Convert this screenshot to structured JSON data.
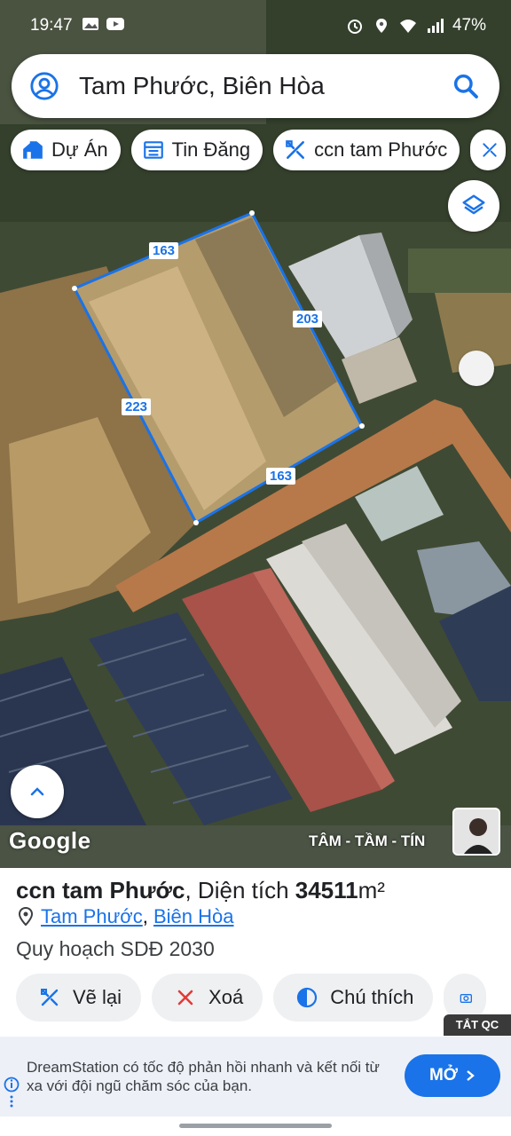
{
  "status_bar": {
    "time": "19:47",
    "battery": "47%",
    "icons": [
      "image-icon",
      "youtube-icon",
      "alarm-icon",
      "location-icon",
      "wifi-icon",
      "signal-icon"
    ]
  },
  "search": {
    "text": "Tam Phước, Biên Hòa",
    "icons": [
      "profile-icon",
      "search-icon"
    ]
  },
  "chips": [
    {
      "label": "Dự Án",
      "icon": "house-icon"
    },
    {
      "label": "Tin Đăng",
      "icon": "listing-icon"
    },
    {
      "label": "ccn tam Phước",
      "icon": "measure-icon"
    }
  ],
  "map": {
    "dimensions": [
      "163",
      "203",
      "223",
      "163"
    ],
    "google_logo": "Google",
    "watermark": "TÂM - TẦM - TÍN",
    "polygon_color": "#1a73e8"
  },
  "sheet": {
    "name": "ccn tam Phước",
    "area_prefix": ", Diện tích ",
    "area_value": "34511",
    "area_unit": "m²",
    "loc_ward": "Tam Phước",
    "loc_sep": ",",
    "loc_city": "Biên Hòa",
    "plan": "Quy hoạch SDĐ 2030",
    "actions": [
      {
        "label": "Vẽ lại",
        "icon": "measure-icon"
      },
      {
        "label": "Xoá",
        "icon": "close-icon"
      },
      {
        "label": "Chú thích",
        "icon": "legend-icon"
      }
    ]
  },
  "ad": {
    "close_label": "TẮT QC",
    "text": "DreamStation có tốc độ phản hồi nhanh và kết nối từ xa với đội ngũ chăm sóc của bạn.",
    "cta": "MỞ"
  }
}
